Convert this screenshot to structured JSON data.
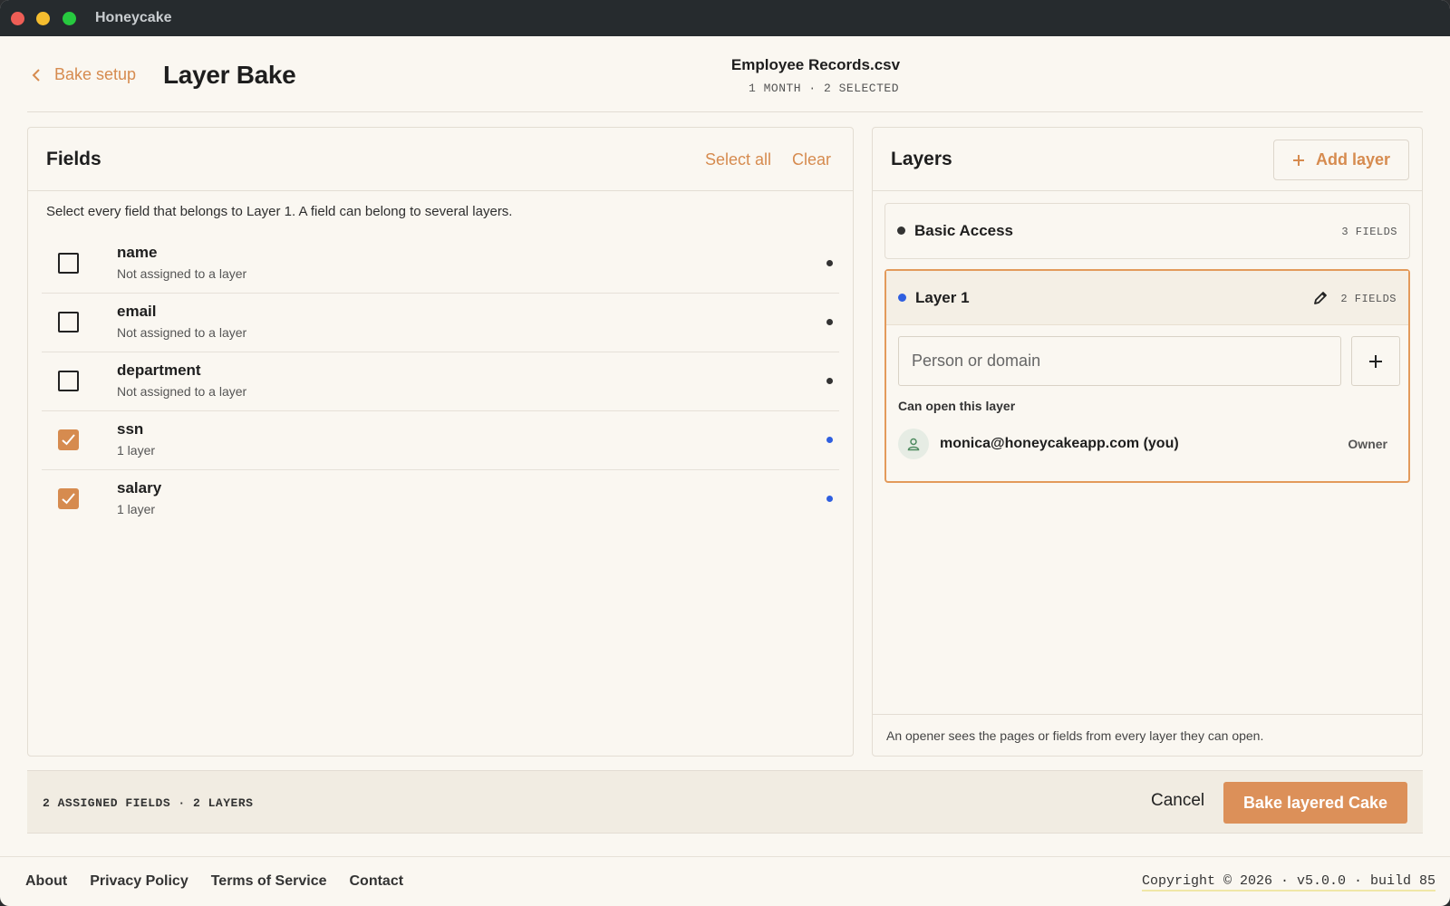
{
  "app": {
    "title": "Honeycake"
  },
  "header": {
    "back_label": "Bake setup",
    "page_title": "Layer Bake",
    "file_name": "Employee Records.csv",
    "file_meta": "1 MONTH · 2 SELECTED"
  },
  "fields_panel": {
    "title": "Fields",
    "select_all": "Select all",
    "clear": "Clear",
    "hint": "Select every field that belongs to Layer 1. A field can belong to several layers.",
    "fields": [
      {
        "name": "name",
        "sub": "Not assigned to a layer",
        "checked": false,
        "dot_color": "#333333"
      },
      {
        "name": "email",
        "sub": "Not assigned to a layer",
        "checked": false,
        "dot_color": "#333333"
      },
      {
        "name": "department",
        "sub": "Not assigned to a layer",
        "checked": false,
        "dot_color": "#333333"
      },
      {
        "name": "ssn",
        "sub": "1 layer",
        "checked": true,
        "dot_color": "#2f5fe0"
      },
      {
        "name": "salary",
        "sub": "1 layer",
        "checked": true,
        "dot_color": "#2f5fe0"
      }
    ]
  },
  "layers_panel": {
    "title": "Layers",
    "add_layer": "Add layer",
    "layers": [
      {
        "name": "Basic Access",
        "count": "3 FIELDS",
        "dot_color": "#333333"
      },
      {
        "name": "Layer 1",
        "count": "2 FIELDS",
        "dot_color": "#2f5fe0"
      }
    ],
    "person_placeholder": "Person or domain",
    "can_open_label": "Can open this layer",
    "openers": [
      {
        "email": "monica@honeycakeapp.com (you)",
        "role": "Owner"
      }
    ],
    "footer_note": "An opener sees the pages or fields from every layer they can open."
  },
  "action_bar": {
    "summary": "2 ASSIGNED FIELDS · 2 LAYERS",
    "cancel": "Cancel",
    "bake": "Bake layered Cake"
  },
  "footer": {
    "links": [
      "About",
      "Privacy Policy",
      "Terms of Service",
      "Contact"
    ],
    "copyright": "Copyright © 2026 · v5.0.0 · build 85"
  },
  "colors": {
    "accent": "#d68b4f",
    "layer_blue": "#2f5fe0",
    "background": "#faf7f1"
  }
}
